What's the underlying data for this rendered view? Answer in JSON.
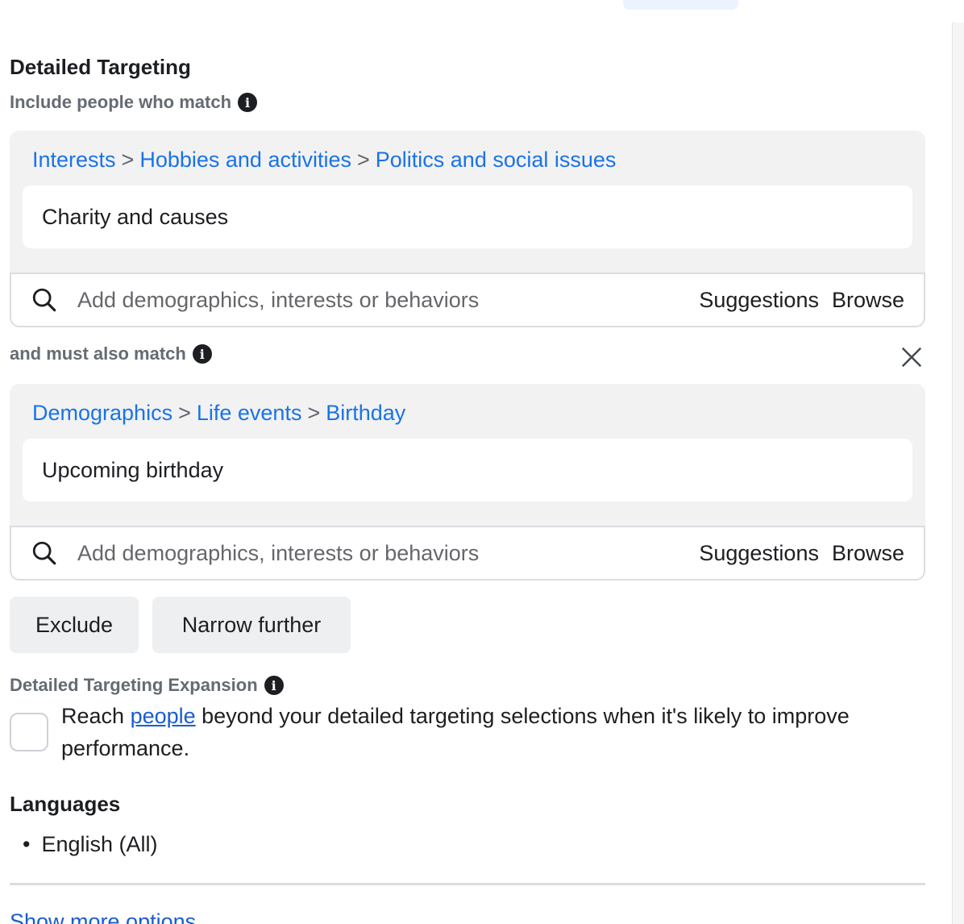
{
  "detailed_targeting": {
    "title": "Detailed Targeting",
    "include_label": "Include people who match",
    "must_also_label": "and must also match"
  },
  "groups": [
    {
      "crumbs": [
        "Interests",
        "Hobbies and activities",
        "Politics and social issues"
      ],
      "item": "Charity and causes",
      "search_placeholder": "Add demographics, interests or behaviors",
      "suggestions_label": "Suggestions",
      "browse_label": "Browse"
    },
    {
      "crumbs": [
        "Demographics",
        "Life events",
        "Birthday"
      ],
      "item": "Upcoming birthday",
      "search_placeholder": "Add demographics, interests or behaviors",
      "suggestions_label": "Suggestions",
      "browse_label": "Browse"
    }
  ],
  "breadcrumb_separator": ">",
  "actions": {
    "exclude_label": "Exclude",
    "narrow_label": "Narrow further"
  },
  "expansion": {
    "title": "Detailed Targeting Expansion",
    "text_before": "Reach ",
    "link": "people",
    "text_after": " beyond your detailed targeting selections when it's likely to improve performance.",
    "checked": false
  },
  "languages": {
    "title": "Languages",
    "items": [
      "English (All)"
    ]
  },
  "show_more_label": "Show more options",
  "colors": {
    "link": "#1a73e8",
    "panel_bg": "#f2f2f2",
    "button_bg": "#eeeff1"
  }
}
